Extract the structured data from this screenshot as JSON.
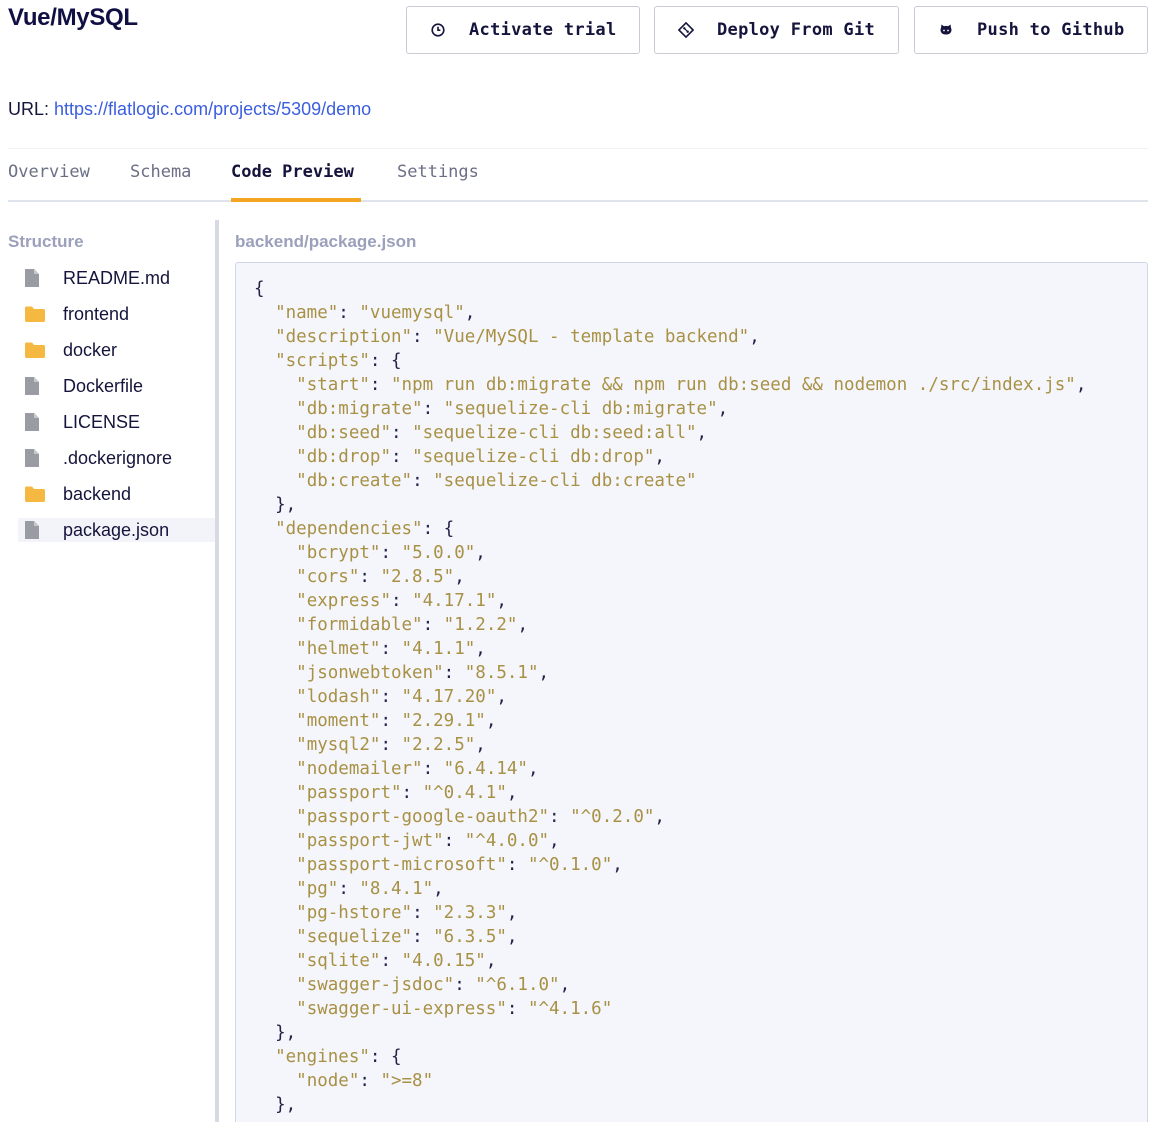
{
  "header": {
    "title": "Vue/MySQL",
    "buttons": {
      "activate_trial": "Activate trial",
      "deploy_from_git": "Deploy From Git",
      "push_to_github": "Push to Github"
    },
    "url_label": "URL:",
    "url": "https://flatlogic.com/projects/5309/demo"
  },
  "tabs": [
    {
      "label": "Overview"
    },
    {
      "label": "Schema"
    },
    {
      "label": "Code Preview",
      "active": true
    },
    {
      "label": "Settings"
    }
  ],
  "sidebar": {
    "heading": "Structure",
    "items": [
      {
        "label": "README.md",
        "type": "file",
        "icon": "file-icon"
      },
      {
        "label": "frontend",
        "type": "folder",
        "icon": "folder-icon"
      },
      {
        "label": "docker",
        "type": "folder",
        "icon": "folder-icon"
      },
      {
        "label": "Dockerfile",
        "type": "file",
        "icon": "file-icon"
      },
      {
        "label": "LICENSE",
        "type": "file",
        "icon": "file-icon"
      },
      {
        "label": ".dockerignore",
        "type": "file",
        "icon": "file-icon"
      },
      {
        "label": "backend",
        "type": "folder",
        "icon": "folder-icon"
      },
      {
        "label": "package.json",
        "type": "file",
        "icon": "file-icon",
        "selected": true
      }
    ]
  },
  "editor": {
    "path": "backend/package.json",
    "lines": [
      [
        [
          "{",
          "p"
        ]
      ],
      [
        [
          "  ",
          "p"
        ],
        [
          "\"name\"",
          "k"
        ],
        [
          ": ",
          "p"
        ],
        [
          "\"vuemysql\"",
          "k"
        ],
        [
          ",",
          "p"
        ]
      ],
      [
        [
          "  ",
          "p"
        ],
        [
          "\"description\"",
          "k"
        ],
        [
          ": ",
          "p"
        ],
        [
          "\"Vue/MySQL - template backend\"",
          "k"
        ],
        [
          ",",
          "p"
        ]
      ],
      [
        [
          "  ",
          "p"
        ],
        [
          "\"scripts\"",
          "k"
        ],
        [
          ": {",
          "p"
        ]
      ],
      [
        [
          "    ",
          "p"
        ],
        [
          "\"start\"",
          "k"
        ],
        [
          ": ",
          "p"
        ],
        [
          "\"npm run db:migrate && npm run db:seed && nodemon ./src/index.js\"",
          "k"
        ],
        [
          ",",
          "p"
        ]
      ],
      [
        [
          "    ",
          "p"
        ],
        [
          "\"db:migrate\"",
          "k"
        ],
        [
          ": ",
          "p"
        ],
        [
          "\"sequelize-cli db:migrate\"",
          "k"
        ],
        [
          ",",
          "p"
        ]
      ],
      [
        [
          "    ",
          "p"
        ],
        [
          "\"db:seed\"",
          "k"
        ],
        [
          ": ",
          "p"
        ],
        [
          "\"sequelize-cli db:seed:all\"",
          "k"
        ],
        [
          ",",
          "p"
        ]
      ],
      [
        [
          "    ",
          "p"
        ],
        [
          "\"db:drop\"",
          "k"
        ],
        [
          ": ",
          "p"
        ],
        [
          "\"sequelize-cli db:drop\"",
          "k"
        ],
        [
          ",",
          "p"
        ]
      ],
      [
        [
          "    ",
          "p"
        ],
        [
          "\"db:create\"",
          "k"
        ],
        [
          ": ",
          "p"
        ],
        [
          "\"sequelize-cli db:create\"",
          "k"
        ]
      ],
      [
        [
          "  },",
          "p"
        ]
      ],
      [
        [
          "  ",
          "p"
        ],
        [
          "\"dependencies\"",
          "k"
        ],
        [
          ": {",
          "p"
        ]
      ],
      [
        [
          "    ",
          "p"
        ],
        [
          "\"bcrypt\"",
          "k"
        ],
        [
          ": ",
          "p"
        ],
        [
          "\"5.0.0\"",
          "k"
        ],
        [
          ",",
          "p"
        ]
      ],
      [
        [
          "    ",
          "p"
        ],
        [
          "\"cors\"",
          "k"
        ],
        [
          ": ",
          "p"
        ],
        [
          "\"2.8.5\"",
          "k"
        ],
        [
          ",",
          "p"
        ]
      ],
      [
        [
          "    ",
          "p"
        ],
        [
          "\"express\"",
          "k"
        ],
        [
          ": ",
          "p"
        ],
        [
          "\"4.17.1\"",
          "k"
        ],
        [
          ",",
          "p"
        ]
      ],
      [
        [
          "    ",
          "p"
        ],
        [
          "\"formidable\"",
          "k"
        ],
        [
          ": ",
          "p"
        ],
        [
          "\"1.2.2\"",
          "k"
        ],
        [
          ",",
          "p"
        ]
      ],
      [
        [
          "    ",
          "p"
        ],
        [
          "\"helmet\"",
          "k"
        ],
        [
          ": ",
          "p"
        ],
        [
          "\"4.1.1\"",
          "k"
        ],
        [
          ",",
          "p"
        ]
      ],
      [
        [
          "    ",
          "p"
        ],
        [
          "\"jsonwebtoken\"",
          "k"
        ],
        [
          ": ",
          "p"
        ],
        [
          "\"8.5.1\"",
          "k"
        ],
        [
          ",",
          "p"
        ]
      ],
      [
        [
          "    ",
          "p"
        ],
        [
          "\"lodash\"",
          "k"
        ],
        [
          ": ",
          "p"
        ],
        [
          "\"4.17.20\"",
          "k"
        ],
        [
          ",",
          "p"
        ]
      ],
      [
        [
          "    ",
          "p"
        ],
        [
          "\"moment\"",
          "k"
        ],
        [
          ": ",
          "p"
        ],
        [
          "\"2.29.1\"",
          "k"
        ],
        [
          ",",
          "p"
        ]
      ],
      [
        [
          "    ",
          "p"
        ],
        [
          "\"mysql2\"",
          "k"
        ],
        [
          ": ",
          "p"
        ],
        [
          "\"2.2.5\"",
          "k"
        ],
        [
          ",",
          "p"
        ]
      ],
      [
        [
          "    ",
          "p"
        ],
        [
          "\"nodemailer\"",
          "k"
        ],
        [
          ": ",
          "p"
        ],
        [
          "\"6.4.14\"",
          "k"
        ],
        [
          ",",
          "p"
        ]
      ],
      [
        [
          "    ",
          "p"
        ],
        [
          "\"passport\"",
          "k"
        ],
        [
          ": ",
          "p"
        ],
        [
          "\"^0.4.1\"",
          "k"
        ],
        [
          ",",
          "p"
        ]
      ],
      [
        [
          "    ",
          "p"
        ],
        [
          "\"passport-google-oauth2\"",
          "k"
        ],
        [
          ": ",
          "p"
        ],
        [
          "\"^0.2.0\"",
          "k"
        ],
        [
          ",",
          "p"
        ]
      ],
      [
        [
          "    ",
          "p"
        ],
        [
          "\"passport-jwt\"",
          "k"
        ],
        [
          ": ",
          "p"
        ],
        [
          "\"^4.0.0\"",
          "k"
        ],
        [
          ",",
          "p"
        ]
      ],
      [
        [
          "    ",
          "p"
        ],
        [
          "\"passport-microsoft\"",
          "k"
        ],
        [
          ": ",
          "p"
        ],
        [
          "\"^0.1.0\"",
          "k"
        ],
        [
          ",",
          "p"
        ]
      ],
      [
        [
          "    ",
          "p"
        ],
        [
          "\"pg\"",
          "k"
        ],
        [
          ": ",
          "p"
        ],
        [
          "\"8.4.1\"",
          "k"
        ],
        [
          ",",
          "p"
        ]
      ],
      [
        [
          "    ",
          "p"
        ],
        [
          "\"pg-hstore\"",
          "k"
        ],
        [
          ": ",
          "p"
        ],
        [
          "\"2.3.3\"",
          "k"
        ],
        [
          ",",
          "p"
        ]
      ],
      [
        [
          "    ",
          "p"
        ],
        [
          "\"sequelize\"",
          "k"
        ],
        [
          ": ",
          "p"
        ],
        [
          "\"6.3.5\"",
          "k"
        ],
        [
          ",",
          "p"
        ]
      ],
      [
        [
          "    ",
          "p"
        ],
        [
          "\"sqlite\"",
          "k"
        ],
        [
          ": ",
          "p"
        ],
        [
          "\"4.0.15\"",
          "k"
        ],
        [
          ",",
          "p"
        ]
      ],
      [
        [
          "    ",
          "p"
        ],
        [
          "\"swagger-jsdoc\"",
          "k"
        ],
        [
          ": ",
          "p"
        ],
        [
          "\"^6.1.0\"",
          "k"
        ],
        [
          ",",
          "p"
        ]
      ],
      [
        [
          "    ",
          "p"
        ],
        [
          "\"swagger-ui-express\"",
          "k"
        ],
        [
          ": ",
          "p"
        ],
        [
          "\"^4.1.6\"",
          "k"
        ]
      ],
      [
        [
          "  },",
          "p"
        ]
      ],
      [
        [
          "  ",
          "p"
        ],
        [
          "\"engines\"",
          "k"
        ],
        [
          ": {",
          "p"
        ]
      ],
      [
        [
          "    ",
          "p"
        ],
        [
          "\"node\"",
          "k"
        ],
        [
          ": ",
          "p"
        ],
        [
          "\">=8\"",
          "k"
        ]
      ],
      [
        [
          "  },",
          "p"
        ]
      ]
    ]
  },
  "colors": {
    "accent_underline": "#f5a524",
    "link": "#3b5ee0",
    "json_token": "#a89145",
    "folder": "#f5b942",
    "file": "#9a9ca3"
  }
}
